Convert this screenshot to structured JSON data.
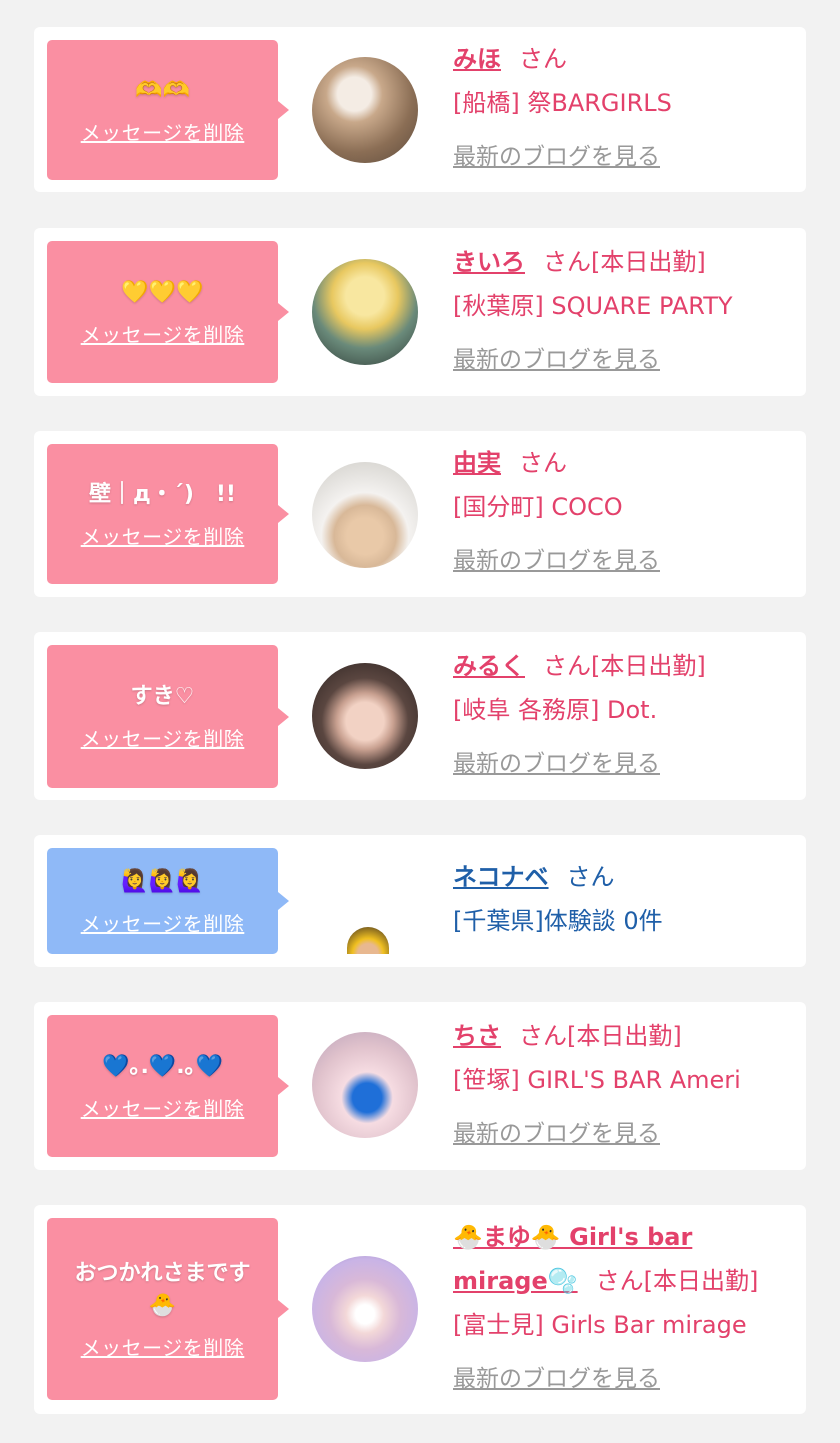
{
  "delete_label": "メッセージを削除",
  "blog_label": "最新のブログを見る",
  "san_label": "さん",
  "cards": [
    {
      "message": "🫶🫶",
      "name": "みほ",
      "status": "",
      "area": "[船橋]",
      "shop": "祭BARGIRLS"
    },
    {
      "message": "💛💛💛",
      "name": "きいろ",
      "status": "[本日出勤]",
      "area": "[秋葉原]",
      "shop": "SQUARE PARTY"
    },
    {
      "message": "壁｜д・´)　!!",
      "name": "由実",
      "status": "",
      "area": "[国分町]",
      "shop": "COCO"
    },
    {
      "message": "すき♡",
      "name": "みるく",
      "status": "[本日出勤]",
      "area": "[岐阜 各務原]",
      "shop": "Dot."
    },
    {
      "message": "🙋‍♀️🙋‍♀️🙋‍♀️",
      "name": "ネコナベ",
      "status": "",
      "area": "[千葉県]",
      "shop": "体験談 0件"
    },
    {
      "message": "💙｡.💙.｡💙",
      "name": "ちさ",
      "status": "[本日出勤]",
      "area": "[笹塚]",
      "shop": "GIRL'S BAR Ameri"
    },
    {
      "message": "おつかれさまです\n🐣",
      "name_line1": "🐣まゆ🐣 Girl's bar",
      "name_line2": "mirage🫧",
      "status": "[本日出勤]",
      "area": "[富士見]",
      "shop": "Girls Bar mirage"
    }
  ],
  "colors": {
    "background": "#f2f2f2",
    "bubble_pink": "#fa8fa2",
    "bubble_blue": "#8fb9f7",
    "name_pink": "#e3416b",
    "name_blue": "#1f5fa8",
    "blog_gray": "#999999"
  },
  "avatar_colors": [
    "#b8a48e",
    "#6a8a7a",
    "#e8e2dc",
    "#4a3a34",
    "#f0c020",
    "#f5c9d4",
    "#c9b4e6"
  ]
}
